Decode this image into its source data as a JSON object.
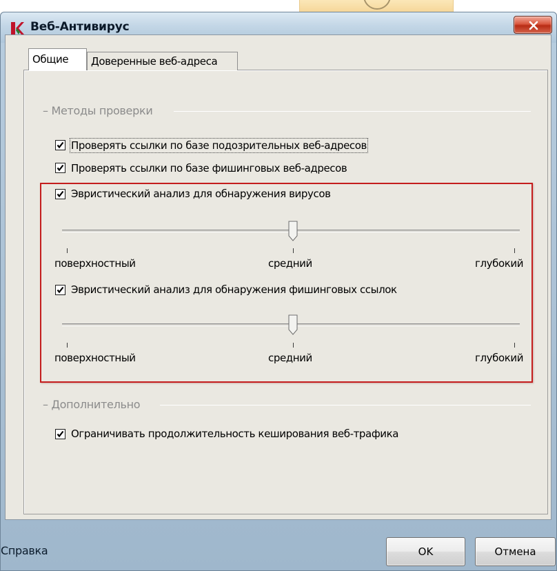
{
  "window": {
    "title": "Веб-Антивирус",
    "close_label": "x"
  },
  "tabs": [
    {
      "label": "Общие",
      "active": true
    },
    {
      "label": "Доверенные веб-адреса",
      "active": false
    }
  ],
  "groups": {
    "scan_methods": {
      "legend": "– Методы проверки",
      "check_suspicious": {
        "label": "Проверять ссылки по базе подозрительных веб-адресов",
        "checked": true
      },
      "check_phishing": {
        "label": "Проверять ссылки по базе фишинговых веб-адресов",
        "checked": true
      },
      "heuristic_viruses": {
        "label": "Эвристический анализ для обнаружения вирусов",
        "checked": true,
        "level": 0.5
      },
      "heuristic_phishing": {
        "label": "Эвристический анализ для обнаружения фишинговых ссылок",
        "checked": true,
        "level": 0.5
      }
    },
    "additional": {
      "legend": "– Дополнительно",
      "limit_caching": {
        "label": "Ограничивать продолжительность кеширования веб-трафика",
        "checked": true
      }
    }
  },
  "scale_labels": {
    "low": "поверхностный",
    "mid": "средний",
    "high": "глубокий"
  },
  "footer": {
    "help_link": "Справка",
    "ok_label": "OK",
    "cancel_label": "Отмена"
  },
  "colors": {
    "highlight": "#c41d1d",
    "panel": "#eae8e1"
  }
}
